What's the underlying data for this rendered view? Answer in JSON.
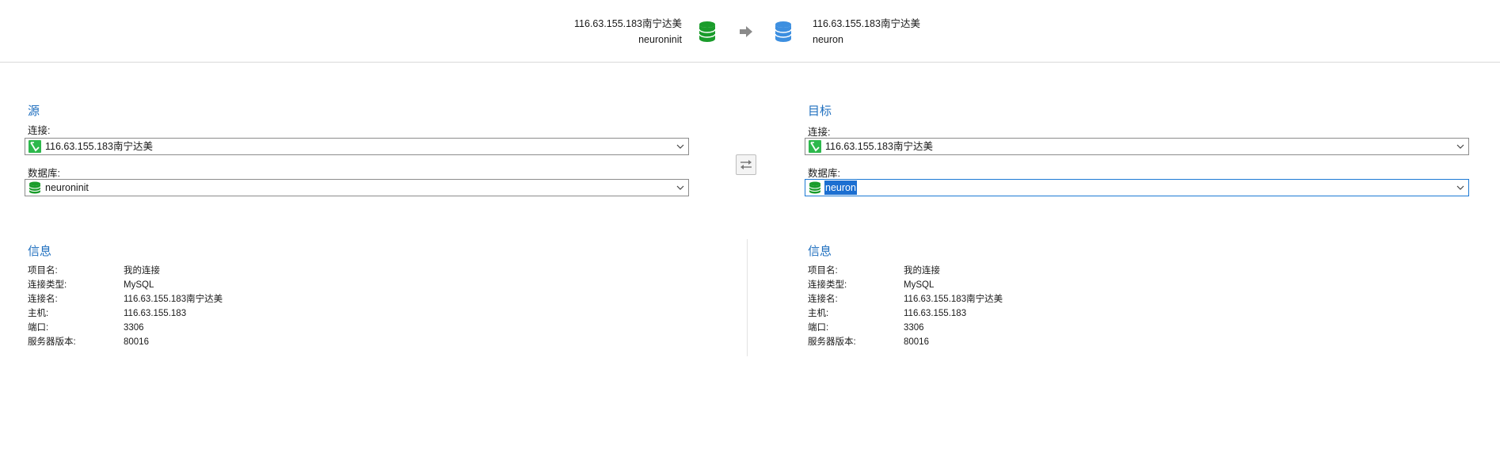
{
  "header": {
    "source": {
      "connection": "116.63.155.183南宁达美",
      "database": "neuroninit",
      "icon": "database-icon",
      "icon_color": "#1a9c2b"
    },
    "target": {
      "connection": "116.63.155.183南宁达美",
      "database": "neuron",
      "icon": "database-icon",
      "icon_color": "#3d8fe0"
    },
    "arrow_icon": "arrow-right-icon"
  },
  "source": {
    "title": "源",
    "connection_label": "连接:",
    "connection_value": "116.63.155.183南宁达美",
    "database_label": "数据库:",
    "database_value": "neuroninit"
  },
  "target": {
    "title": "目标",
    "connection_label": "连接:",
    "connection_value": "116.63.155.183南宁达美",
    "database_label": "数据库:",
    "database_value": "neuron"
  },
  "swap_button": {
    "icon": "swap-icon"
  },
  "source_info": {
    "title": "信息",
    "rows": [
      {
        "key": "项目名:",
        "value": "我的连接"
      },
      {
        "key": "连接类型:",
        "value": "MySQL"
      },
      {
        "key": "连接名:",
        "value": "116.63.155.183南宁达美"
      },
      {
        "key": "主机:",
        "value": "116.63.155.183"
      },
      {
        "key": "端口:",
        "value": "3306"
      },
      {
        "key": "服务器版本:",
        "value": "80016"
      }
    ]
  },
  "target_info": {
    "title": "信息",
    "rows": [
      {
        "key": "项目名:",
        "value": "我的连接"
      },
      {
        "key": "连接类型:",
        "value": "MySQL"
      },
      {
        "key": "连接名:",
        "value": "116.63.155.183南宁达美"
      },
      {
        "key": "主机:",
        "value": "116.63.155.183"
      },
      {
        "key": "端口:",
        "value": "3306"
      },
      {
        "key": "服务器版本:",
        "value": "80016"
      }
    ]
  },
  "colors": {
    "accent": "#1f6fbf",
    "selection": "#1c6fd1",
    "mysql_green": "#2db84c"
  }
}
